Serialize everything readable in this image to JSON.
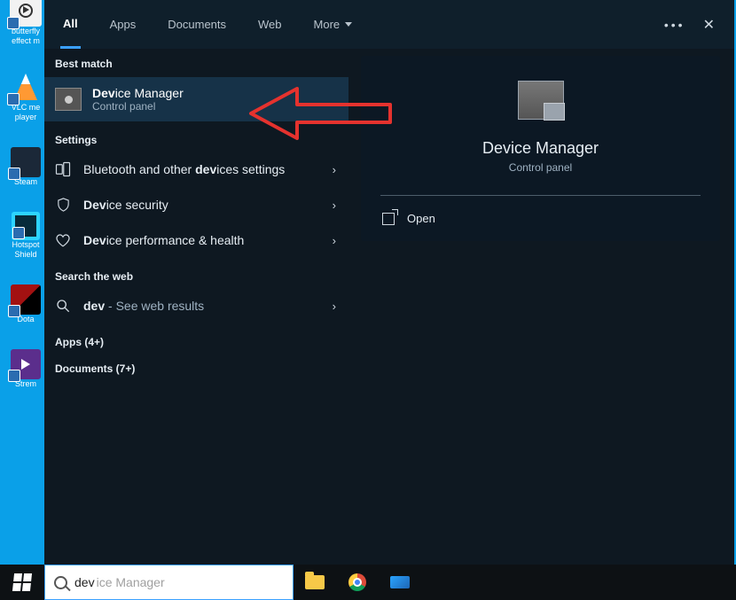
{
  "desktop_icons": [
    {
      "label": "butterfly effect m"
    },
    {
      "label": "VLC me player"
    },
    {
      "label": "Steam"
    },
    {
      "label": "Hotspot Shield"
    },
    {
      "label": "Dota"
    },
    {
      "label": "Strem"
    }
  ],
  "tabs": {
    "all": "All",
    "apps": "Apps",
    "documents": "Documents",
    "web": "Web",
    "more": "More"
  },
  "left": {
    "best_match": "Best match",
    "best": {
      "title_pre": "Dev",
      "title_post": "ice Manager",
      "sub": "Control panel"
    },
    "settings_hdr": "Settings",
    "row_bt_pre": "Bluetooth and other ",
    "row_bt_bold": "dev",
    "row_bt_post": "ices settings",
    "row_sec_pre": "Dev",
    "row_sec_post": "ice security",
    "row_perf_pre": "Dev",
    "row_perf_post": "ice performance & health",
    "web_hdr": "Search the web",
    "row_web_pre": "dev",
    "row_web_post": " - See web results",
    "apps_hdr": "Apps (4+)",
    "docs_hdr": "Documents (7+)"
  },
  "right": {
    "title": "Device Manager",
    "sub": "Control panel",
    "open": "Open"
  },
  "search": {
    "typed": "dev",
    "ghost": "ice Manager"
  }
}
